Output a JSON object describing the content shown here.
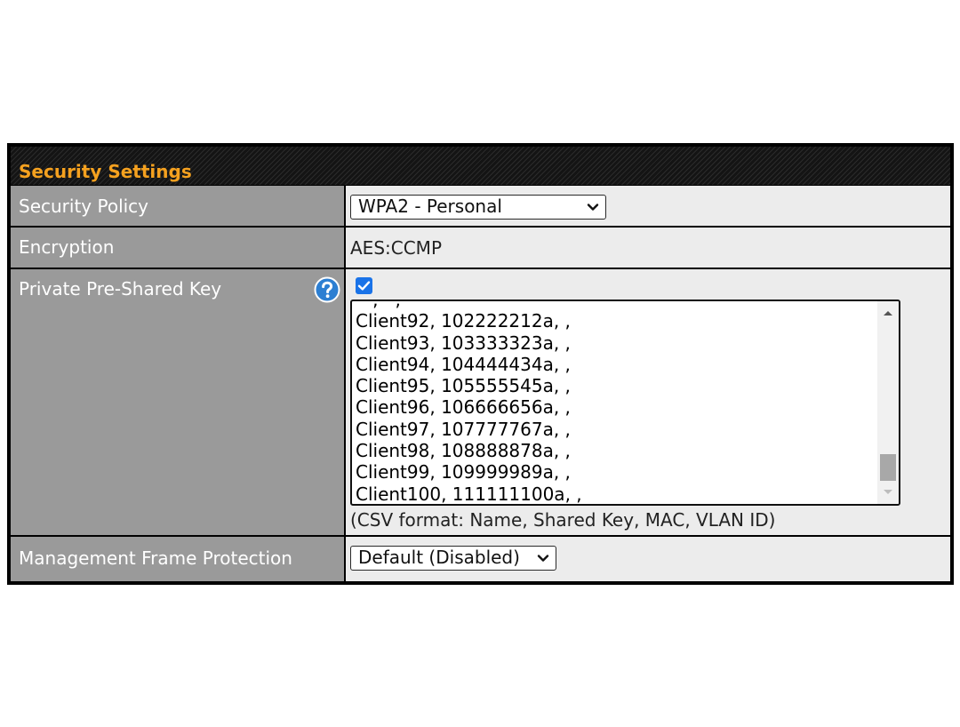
{
  "security_settings": {
    "title": "Security Settings",
    "security_policy": {
      "label": "Security Policy",
      "value": "WPA2 - Personal"
    },
    "encryption": {
      "label": "Encryption",
      "value": "AES:CCMP"
    },
    "private_psk": {
      "label": "Private Pre-Shared Key",
      "help_icon": "question-circle-icon",
      "enabled": true,
      "clients": [
        "Client92, 102222212a, ,",
        "Client93, 103333323a, ,",
        "Client94, 104444434a, ,",
        "Client95, 105555545a, ,",
        "Client96, 106666656a, ,",
        "Client97, 107777767a, ,",
        "Client98, 108888878a, ,",
        "Client99, 109999989a, ,",
        "Client100, 111111100a, ,"
      ],
      "hint": "(CSV format: Name, Shared Key, MAC, VLAN ID)"
    },
    "mgmt_frame_protection": {
      "label": "Management Frame Protection",
      "value": "Default (Disabled)"
    }
  },
  "colors": {
    "header_title": "#f5a11f",
    "label_bg": "#9a9a9a",
    "value_bg": "#ececec",
    "checkbox": "#1a73e8",
    "help_icon": "#2d7fd2"
  }
}
